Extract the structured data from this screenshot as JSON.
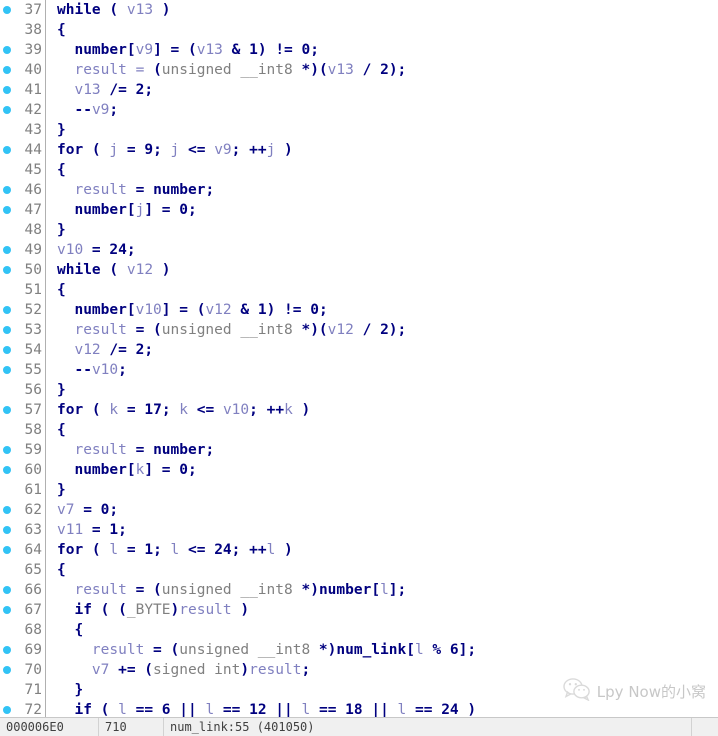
{
  "app": {
    "view_name": "Pseudocode",
    "theme": "light",
    "accent_marker_color": "#31c3f5",
    "line_number_color": "#808080",
    "keyword_color": "#00007f",
    "variable_color": "#8080c0",
    "type_color": "#808080"
  },
  "editor": {
    "first_line": 37,
    "last_line": 72,
    "lines": [
      {
        "n": 37,
        "marker": true,
        "tokens": [
          {
            "t": "kw",
            "s": "while"
          },
          {
            "t": "plain",
            "s": " ( "
          },
          {
            "t": "var",
            "s": "v13"
          },
          {
            "t": "plain",
            "s": " )"
          }
        ]
      },
      {
        "n": 38,
        "marker": false,
        "tokens": [
          {
            "t": "punc",
            "s": "{"
          }
        ]
      },
      {
        "n": 39,
        "marker": true,
        "tokens": [
          {
            "t": "plain",
            "s": "  "
          },
          {
            "t": "global",
            "s": "number"
          },
          {
            "t": "punc",
            "s": "["
          },
          {
            "t": "var",
            "s": "v9"
          },
          {
            "t": "punc",
            "s": "] = ("
          },
          {
            "t": "var",
            "s": "v13"
          },
          {
            "t": "punc",
            "s": " & "
          },
          {
            "t": "num",
            "s": "1"
          },
          {
            "t": "punc",
            "s": ") != "
          },
          {
            "t": "num",
            "s": "0"
          },
          {
            "t": "punc",
            "s": ";"
          }
        ]
      },
      {
        "n": 40,
        "marker": true,
        "tokens": [
          {
            "t": "plain",
            "s": "  "
          },
          {
            "t": "var",
            "s": "result"
          },
          {
            "t": "var",
            "s": " = "
          },
          {
            "t": "punc",
            "s": "("
          },
          {
            "t": "type",
            "s": "unsigned __int8"
          },
          {
            "t": "punc",
            "s": " *)("
          },
          {
            "t": "var",
            "s": "v13"
          },
          {
            "t": "punc",
            "s": " / "
          },
          {
            "t": "num",
            "s": "2"
          },
          {
            "t": "punc",
            "s": ");"
          }
        ]
      },
      {
        "n": 41,
        "marker": true,
        "tokens": [
          {
            "t": "plain",
            "s": "  "
          },
          {
            "t": "var",
            "s": "v13"
          },
          {
            "t": "punc",
            "s": " /= "
          },
          {
            "t": "num",
            "s": "2"
          },
          {
            "t": "punc",
            "s": ";"
          }
        ]
      },
      {
        "n": 42,
        "marker": true,
        "tokens": [
          {
            "t": "plain",
            "s": "  "
          },
          {
            "t": "punc",
            "s": "--"
          },
          {
            "t": "var",
            "s": "v9"
          },
          {
            "t": "punc",
            "s": ";"
          }
        ]
      },
      {
        "n": 43,
        "marker": false,
        "tokens": [
          {
            "t": "punc",
            "s": "}"
          }
        ]
      },
      {
        "n": 44,
        "marker": true,
        "tokens": [
          {
            "t": "kw",
            "s": "for"
          },
          {
            "t": "plain",
            "s": " ( "
          },
          {
            "t": "var",
            "s": "j"
          },
          {
            "t": "punc",
            "s": " = "
          },
          {
            "t": "num",
            "s": "9"
          },
          {
            "t": "punc",
            "s": "; "
          },
          {
            "t": "var",
            "s": "j"
          },
          {
            "t": "punc",
            "s": " <= "
          },
          {
            "t": "var",
            "s": "v9"
          },
          {
            "t": "punc",
            "s": "; ++"
          },
          {
            "t": "var",
            "s": "j"
          },
          {
            "t": "punc",
            "s": " )"
          }
        ]
      },
      {
        "n": 45,
        "marker": false,
        "tokens": [
          {
            "t": "punc",
            "s": "{"
          }
        ]
      },
      {
        "n": 46,
        "marker": true,
        "tokens": [
          {
            "t": "plain",
            "s": "  "
          },
          {
            "t": "var",
            "s": "result"
          },
          {
            "t": "punc",
            "s": " = "
          },
          {
            "t": "global",
            "s": "number"
          },
          {
            "t": "punc",
            "s": ";"
          }
        ]
      },
      {
        "n": 47,
        "marker": true,
        "tokens": [
          {
            "t": "plain",
            "s": "  "
          },
          {
            "t": "global",
            "s": "number"
          },
          {
            "t": "punc",
            "s": "["
          },
          {
            "t": "var",
            "s": "j"
          },
          {
            "t": "punc",
            "s": "] = "
          },
          {
            "t": "num",
            "s": "0"
          },
          {
            "t": "punc",
            "s": ";"
          }
        ]
      },
      {
        "n": 48,
        "marker": false,
        "tokens": [
          {
            "t": "punc",
            "s": "}"
          }
        ]
      },
      {
        "n": 49,
        "marker": true,
        "tokens": [
          {
            "t": "var",
            "s": "v10"
          },
          {
            "t": "punc",
            "s": " = "
          },
          {
            "t": "num",
            "s": "24"
          },
          {
            "t": "punc",
            "s": ";"
          }
        ]
      },
      {
        "n": 50,
        "marker": true,
        "tokens": [
          {
            "t": "kw",
            "s": "while"
          },
          {
            "t": "plain",
            "s": " ( "
          },
          {
            "t": "var",
            "s": "v12"
          },
          {
            "t": "plain",
            "s": " )"
          }
        ]
      },
      {
        "n": 51,
        "marker": false,
        "tokens": [
          {
            "t": "punc",
            "s": "{"
          }
        ]
      },
      {
        "n": 52,
        "marker": true,
        "tokens": [
          {
            "t": "plain",
            "s": "  "
          },
          {
            "t": "global",
            "s": "number"
          },
          {
            "t": "punc",
            "s": "["
          },
          {
            "t": "var",
            "s": "v10"
          },
          {
            "t": "punc",
            "s": "] = ("
          },
          {
            "t": "var",
            "s": "v12"
          },
          {
            "t": "punc",
            "s": " & "
          },
          {
            "t": "num",
            "s": "1"
          },
          {
            "t": "punc",
            "s": ") != "
          },
          {
            "t": "num",
            "s": "0"
          },
          {
            "t": "punc",
            "s": ";"
          }
        ]
      },
      {
        "n": 53,
        "marker": true,
        "tokens": [
          {
            "t": "plain",
            "s": "  "
          },
          {
            "t": "var",
            "s": "result"
          },
          {
            "t": "punc",
            "s": " = ("
          },
          {
            "t": "type",
            "s": "unsigned __int8"
          },
          {
            "t": "punc",
            "s": " *)("
          },
          {
            "t": "var",
            "s": "v12"
          },
          {
            "t": "punc",
            "s": " / "
          },
          {
            "t": "num",
            "s": "2"
          },
          {
            "t": "punc",
            "s": ");"
          }
        ]
      },
      {
        "n": 54,
        "marker": true,
        "tokens": [
          {
            "t": "plain",
            "s": "  "
          },
          {
            "t": "var",
            "s": "v12"
          },
          {
            "t": "punc",
            "s": " /= "
          },
          {
            "t": "num",
            "s": "2"
          },
          {
            "t": "punc",
            "s": ";"
          }
        ]
      },
      {
        "n": 55,
        "marker": true,
        "tokens": [
          {
            "t": "plain",
            "s": "  "
          },
          {
            "t": "punc",
            "s": "--"
          },
          {
            "t": "var",
            "s": "v10"
          },
          {
            "t": "punc",
            "s": ";"
          }
        ]
      },
      {
        "n": 56,
        "marker": false,
        "tokens": [
          {
            "t": "punc",
            "s": "}"
          }
        ]
      },
      {
        "n": 57,
        "marker": true,
        "tokens": [
          {
            "t": "kw",
            "s": "for"
          },
          {
            "t": "plain",
            "s": " ( "
          },
          {
            "t": "var",
            "s": "k"
          },
          {
            "t": "punc",
            "s": " = "
          },
          {
            "t": "num",
            "s": "17"
          },
          {
            "t": "punc",
            "s": "; "
          },
          {
            "t": "var",
            "s": "k"
          },
          {
            "t": "punc",
            "s": " <= "
          },
          {
            "t": "var",
            "s": "v10"
          },
          {
            "t": "punc",
            "s": "; ++"
          },
          {
            "t": "var",
            "s": "k"
          },
          {
            "t": "punc",
            "s": " )"
          }
        ]
      },
      {
        "n": 58,
        "marker": false,
        "tokens": [
          {
            "t": "punc",
            "s": "{"
          }
        ]
      },
      {
        "n": 59,
        "marker": true,
        "tokens": [
          {
            "t": "plain",
            "s": "  "
          },
          {
            "t": "var",
            "s": "result"
          },
          {
            "t": "punc",
            "s": " = "
          },
          {
            "t": "global",
            "s": "number"
          },
          {
            "t": "punc",
            "s": ";"
          }
        ]
      },
      {
        "n": 60,
        "marker": true,
        "tokens": [
          {
            "t": "plain",
            "s": "  "
          },
          {
            "t": "global",
            "s": "number"
          },
          {
            "t": "punc",
            "s": "["
          },
          {
            "t": "var",
            "s": "k"
          },
          {
            "t": "punc",
            "s": "] = "
          },
          {
            "t": "num",
            "s": "0"
          },
          {
            "t": "punc",
            "s": ";"
          }
        ]
      },
      {
        "n": 61,
        "marker": false,
        "tokens": [
          {
            "t": "punc",
            "s": "}"
          }
        ]
      },
      {
        "n": 62,
        "marker": true,
        "tokens": [
          {
            "t": "var",
            "s": "v7"
          },
          {
            "t": "punc",
            "s": " = "
          },
          {
            "t": "num",
            "s": "0"
          },
          {
            "t": "punc",
            "s": ";"
          }
        ]
      },
      {
        "n": 63,
        "marker": true,
        "tokens": [
          {
            "t": "var",
            "s": "v11"
          },
          {
            "t": "punc",
            "s": " = "
          },
          {
            "t": "num",
            "s": "1"
          },
          {
            "t": "punc",
            "s": ";"
          }
        ]
      },
      {
        "n": 64,
        "marker": true,
        "tokens": [
          {
            "t": "kw",
            "s": "for"
          },
          {
            "t": "plain",
            "s": " ( "
          },
          {
            "t": "var",
            "s": "l"
          },
          {
            "t": "punc",
            "s": " = "
          },
          {
            "t": "num",
            "s": "1"
          },
          {
            "t": "punc",
            "s": "; "
          },
          {
            "t": "var",
            "s": "l"
          },
          {
            "t": "punc",
            "s": " <= "
          },
          {
            "t": "num",
            "s": "24"
          },
          {
            "t": "punc",
            "s": "; ++"
          },
          {
            "t": "var",
            "s": "l"
          },
          {
            "t": "punc",
            "s": " )"
          }
        ]
      },
      {
        "n": 65,
        "marker": false,
        "tokens": [
          {
            "t": "punc",
            "s": "{"
          }
        ]
      },
      {
        "n": 66,
        "marker": true,
        "tokens": [
          {
            "t": "plain",
            "s": "  "
          },
          {
            "t": "var",
            "s": "result"
          },
          {
            "t": "punc",
            "s": " = ("
          },
          {
            "t": "type",
            "s": "unsigned __int8"
          },
          {
            "t": "punc",
            "s": " *)"
          },
          {
            "t": "global",
            "s": "number"
          },
          {
            "t": "punc",
            "s": "["
          },
          {
            "t": "var",
            "s": "l"
          },
          {
            "t": "punc",
            "s": "];"
          }
        ]
      },
      {
        "n": 67,
        "marker": true,
        "tokens": [
          {
            "t": "plain",
            "s": "  "
          },
          {
            "t": "kw",
            "s": "if"
          },
          {
            "t": "punc",
            "s": " ( ("
          },
          {
            "t": "type",
            "s": "_BYTE"
          },
          {
            "t": "punc",
            "s": ")"
          },
          {
            "t": "var",
            "s": "result"
          },
          {
            "t": "punc",
            "s": " )"
          }
        ]
      },
      {
        "n": 68,
        "marker": false,
        "tokens": [
          {
            "t": "plain",
            "s": "  "
          },
          {
            "t": "punc",
            "s": "{"
          }
        ]
      },
      {
        "n": 69,
        "marker": true,
        "tokens": [
          {
            "t": "plain",
            "s": "    "
          },
          {
            "t": "var",
            "s": "result"
          },
          {
            "t": "punc",
            "s": " = ("
          },
          {
            "t": "type",
            "s": "unsigned __int8"
          },
          {
            "t": "punc",
            "s": " *)"
          },
          {
            "t": "global",
            "s": "num_link"
          },
          {
            "t": "punc",
            "s": "["
          },
          {
            "t": "var",
            "s": "l"
          },
          {
            "t": "punc",
            "s": " % "
          },
          {
            "t": "num",
            "s": "6"
          },
          {
            "t": "punc",
            "s": "];"
          }
        ]
      },
      {
        "n": 70,
        "marker": true,
        "tokens": [
          {
            "t": "plain",
            "s": "    "
          },
          {
            "t": "var",
            "s": "v7"
          },
          {
            "t": "punc",
            "s": " += ("
          },
          {
            "t": "type",
            "s": "signed int"
          },
          {
            "t": "punc",
            "s": ")"
          },
          {
            "t": "var",
            "s": "result"
          },
          {
            "t": "punc",
            "s": ";"
          }
        ]
      },
      {
        "n": 71,
        "marker": false,
        "tokens": [
          {
            "t": "plain",
            "s": "  "
          },
          {
            "t": "punc",
            "s": "}"
          }
        ]
      },
      {
        "n": 72,
        "marker": true,
        "tokens": [
          {
            "t": "plain",
            "s": "  "
          },
          {
            "t": "kw",
            "s": "if"
          },
          {
            "t": "punc",
            "s": " ( "
          },
          {
            "t": "var",
            "s": "l"
          },
          {
            "t": "punc",
            "s": " == "
          },
          {
            "t": "num",
            "s": "6"
          },
          {
            "t": "punc",
            "s": " || "
          },
          {
            "t": "var",
            "s": "l"
          },
          {
            "t": "punc",
            "s": " == "
          },
          {
            "t": "num",
            "s": "12"
          },
          {
            "t": "punc",
            "s": " || "
          },
          {
            "t": "var",
            "s": "l"
          },
          {
            "t": "punc",
            "s": " == "
          },
          {
            "t": "num",
            "s": "18"
          },
          {
            "t": "punc",
            "s": " || "
          },
          {
            "t": "var",
            "s": "l"
          },
          {
            "t": "punc",
            "s": " == "
          },
          {
            "t": "num",
            "s": "24"
          },
          {
            "t": "punc",
            "s": " )"
          }
        ]
      }
    ]
  },
  "status_bar": {
    "address": "000006E0",
    "offset": "710",
    "location": "num_link:55 (401050)"
  },
  "watermark": {
    "icon": "wechat-icon",
    "text": "Lpy Now的小窝"
  }
}
